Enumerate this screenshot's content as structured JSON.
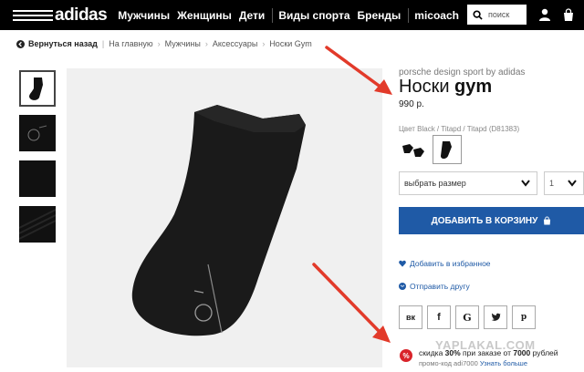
{
  "nav": {
    "logo": "adidas",
    "items": [
      "Мужчины",
      "Женщины",
      "Дети"
    ],
    "items2": [
      "Виды спорта",
      "Бренды"
    ],
    "items3": [
      "micoach"
    ],
    "search_placeholder": "поиск",
    "icons": [
      "search-icon",
      "user-icon",
      "cart-icon"
    ]
  },
  "breadcrumb": {
    "back": "Вернуться назад",
    "crumbs": [
      "На главную",
      "Мужчины",
      "Аксессуары",
      "Носки Gym"
    ]
  },
  "product": {
    "brand_line": "porsche design sport by adidas",
    "title_prefix": "Носки ",
    "title_bold": "gym",
    "price": "990 р.",
    "color_line": "Цвет Black / Titapd / Titapd (D81383)",
    "size_select": "выбрать размер",
    "qty": "1",
    "add_to_cart": "ДОБАВИТЬ В КОРЗИНУ",
    "wishlist": "Добавить в избранное",
    "send_friend": "Отправить другу",
    "share": [
      "вк",
      "f",
      "G",
      "twitter",
      "p"
    ]
  },
  "promo": {
    "badge": "%",
    "text_a": "скидка ",
    "text_b": "30%",
    "text_c": " при заказе от ",
    "text_d": "7000",
    "text_e": " рублей",
    "code": "промо-код adi7000",
    "more": "Узнать больше"
  },
  "watermark": "YAPLAKAL.COM",
  "colors": {
    "nav_bg": "#000000",
    "accent_blue": "#1f5aa6",
    "arrow_red": "#e23a2a",
    "promo_red": "#d9232a"
  }
}
